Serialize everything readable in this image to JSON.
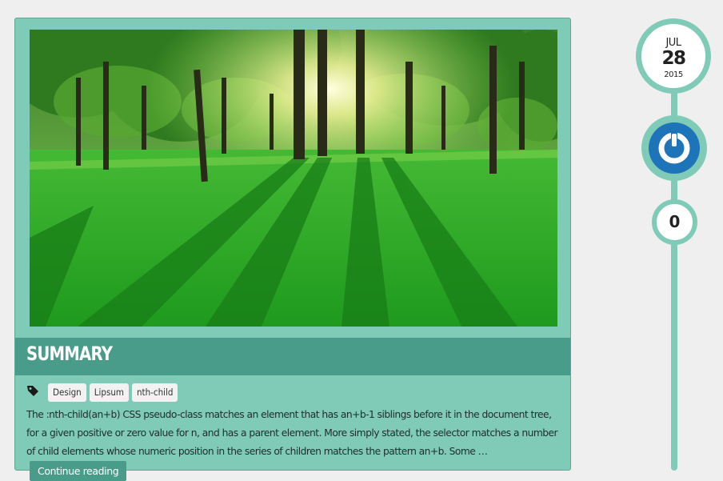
{
  "post": {
    "title": "SUMMARY",
    "tags": [
      "Design",
      "Lipsum",
      "nth-child"
    ],
    "excerpt": "The :nth-child(an+b) CSS pseudo-class matches an element that has an+b-1 siblings before it in the document tree, for a given positive or zero value for n, and has a parent element. More simply stated, the selector matches a number of child elements whose numeric position in the series of children matches the pattern an+b. Some …",
    "continue_label": "Continue reading"
  },
  "meta": {
    "month": "JUL",
    "day": "28",
    "year": "2015",
    "comment_count": "0"
  },
  "colors": {
    "accent": "#7fcbb8",
    "accent_dark": "#4a9c8a",
    "avatar_blue": "#1d74b8",
    "background": "#efefef"
  },
  "icons": {
    "tag": "tag-icon",
    "avatar": "power-logo-icon",
    "image": "forest-park-image"
  }
}
